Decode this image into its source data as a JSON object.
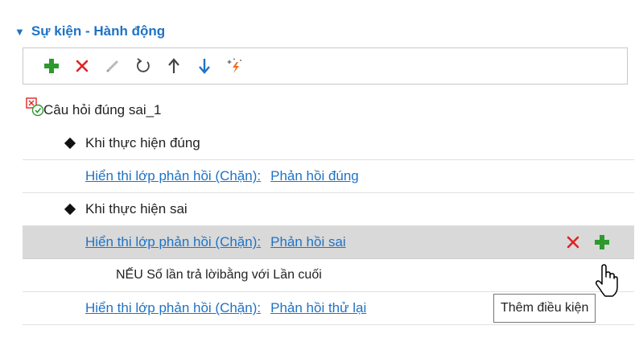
{
  "section": {
    "title": "Sự kiện - Hành động"
  },
  "toolbar": {
    "buttons": [
      {
        "name": "add",
        "icon": "plus-icon",
        "color": "#2e9a2e"
      },
      {
        "name": "delete",
        "icon": "x-icon",
        "color": "#e02424"
      },
      {
        "name": "edit",
        "icon": "pencil-icon",
        "color": "#b9b9b9"
      },
      {
        "name": "undo",
        "icon": "rotate-icon",
        "color": "#444444"
      },
      {
        "name": "move-up",
        "icon": "arrow-up-icon",
        "color": "#444444"
      },
      {
        "name": "move-down",
        "icon": "arrow-down-icon",
        "color": "#1f73c5"
      },
      {
        "name": "trigger",
        "icon": "sparkle-lightning-icon",
        "color": "#f26b1d"
      }
    ]
  },
  "tree": {
    "root_label": "Câu hỏi đúng sai_1",
    "event_correct": "Khi thực hiện đúng",
    "action_correct": {
      "verb": "Hiển thi lớp phản hồi (Chặn):",
      "target": "Phản hồi đúng"
    },
    "event_wrong": "Khi thực hiện sai",
    "action_wrong": {
      "verb": "Hiển thi lớp phản hồi (Chặn):",
      "target": "Phản hồi sai"
    },
    "condition": "NẾU Số lần trả lờibằng với Lần cuối",
    "action_retry": {
      "verb": "Hiển thi lớp phản hồi (Chặn):",
      "target": "Phản hồi thử lại"
    }
  },
  "tooltip": {
    "text": "Thêm điều kiện"
  },
  "colors": {
    "accent": "#1f73c5",
    "add": "#2e9a2e",
    "delete": "#e02424",
    "selected_row": "#d9d9d9"
  }
}
